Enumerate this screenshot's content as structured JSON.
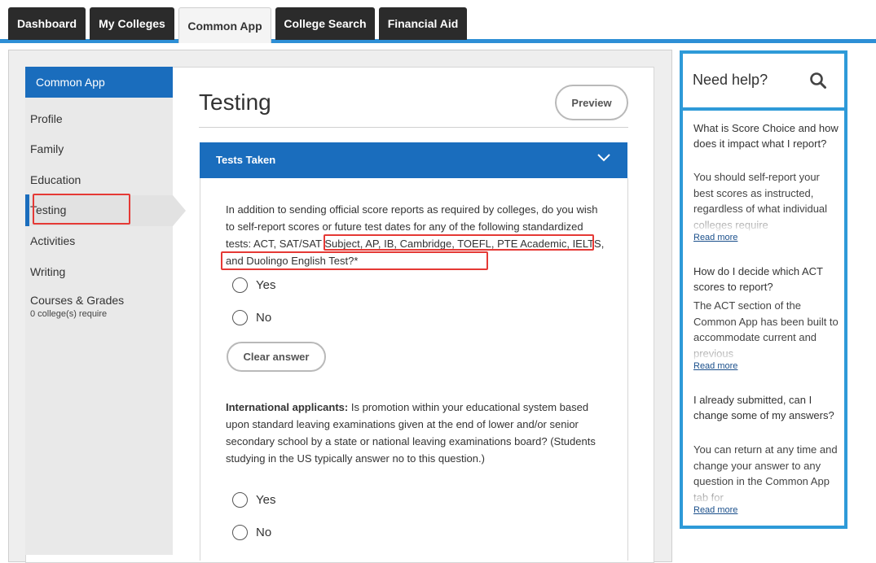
{
  "tabs": [
    "Dashboard",
    "My Colleges",
    "Common App",
    "College Search",
    "Financial Aid"
  ],
  "sidebar": {
    "header": "Common App",
    "items": [
      "Profile",
      "Family",
      "Education",
      "Testing",
      "Activities",
      "Writing",
      "Courses & Grades"
    ],
    "courses_sub": "0 college(s) require"
  },
  "page": {
    "title": "Testing",
    "preview_label": "Preview"
  },
  "section": {
    "title": "Tests Taken",
    "q1_part1": "In addition to sending official score reports as required by colleges, do you wish to self-report scores or future test dates for any of the following standardized tests: ACT, SAT/SAT Subject, AP, IB, Cambridge, TOEFL, PTE Academic, IELTS, and Duolingo English Test?*",
    "yes_label": "Yes",
    "no_label": "No",
    "clear_label": "Clear answer",
    "q2_bold": "International applicants:",
    "q2_text": " Is promotion within your educational system based upon standard leaving examinations given at the end of lower and/or senior secondary school by a state or national leaving examinations board? (Students studying in the US typically answer no to this question.)"
  },
  "help": {
    "title": "Need help?",
    "items": [
      {
        "question": "What is Score Choice and how does it impact what I report?",
        "answer": "You should self-report your best scores as instructed, regardless of what individual colleges require",
        "link": "Read more"
      },
      {
        "question": "How do I decide which ACT scores to report?",
        "answer": "The ACT section of the Common App has been built to accommodate current and previous",
        "link": "Read more"
      },
      {
        "question": "I already submitted, can I change some of my answers?",
        "answer": "You can return at any time and change your answer to any question in the Common App tab for",
        "link": "Read more"
      }
    ]
  },
  "colors": {
    "accent_blue": "#1a6dbd",
    "tab_dark": "#2b2b2b",
    "highlight_red": "#e53935",
    "help_border": "#2e9ad8"
  }
}
